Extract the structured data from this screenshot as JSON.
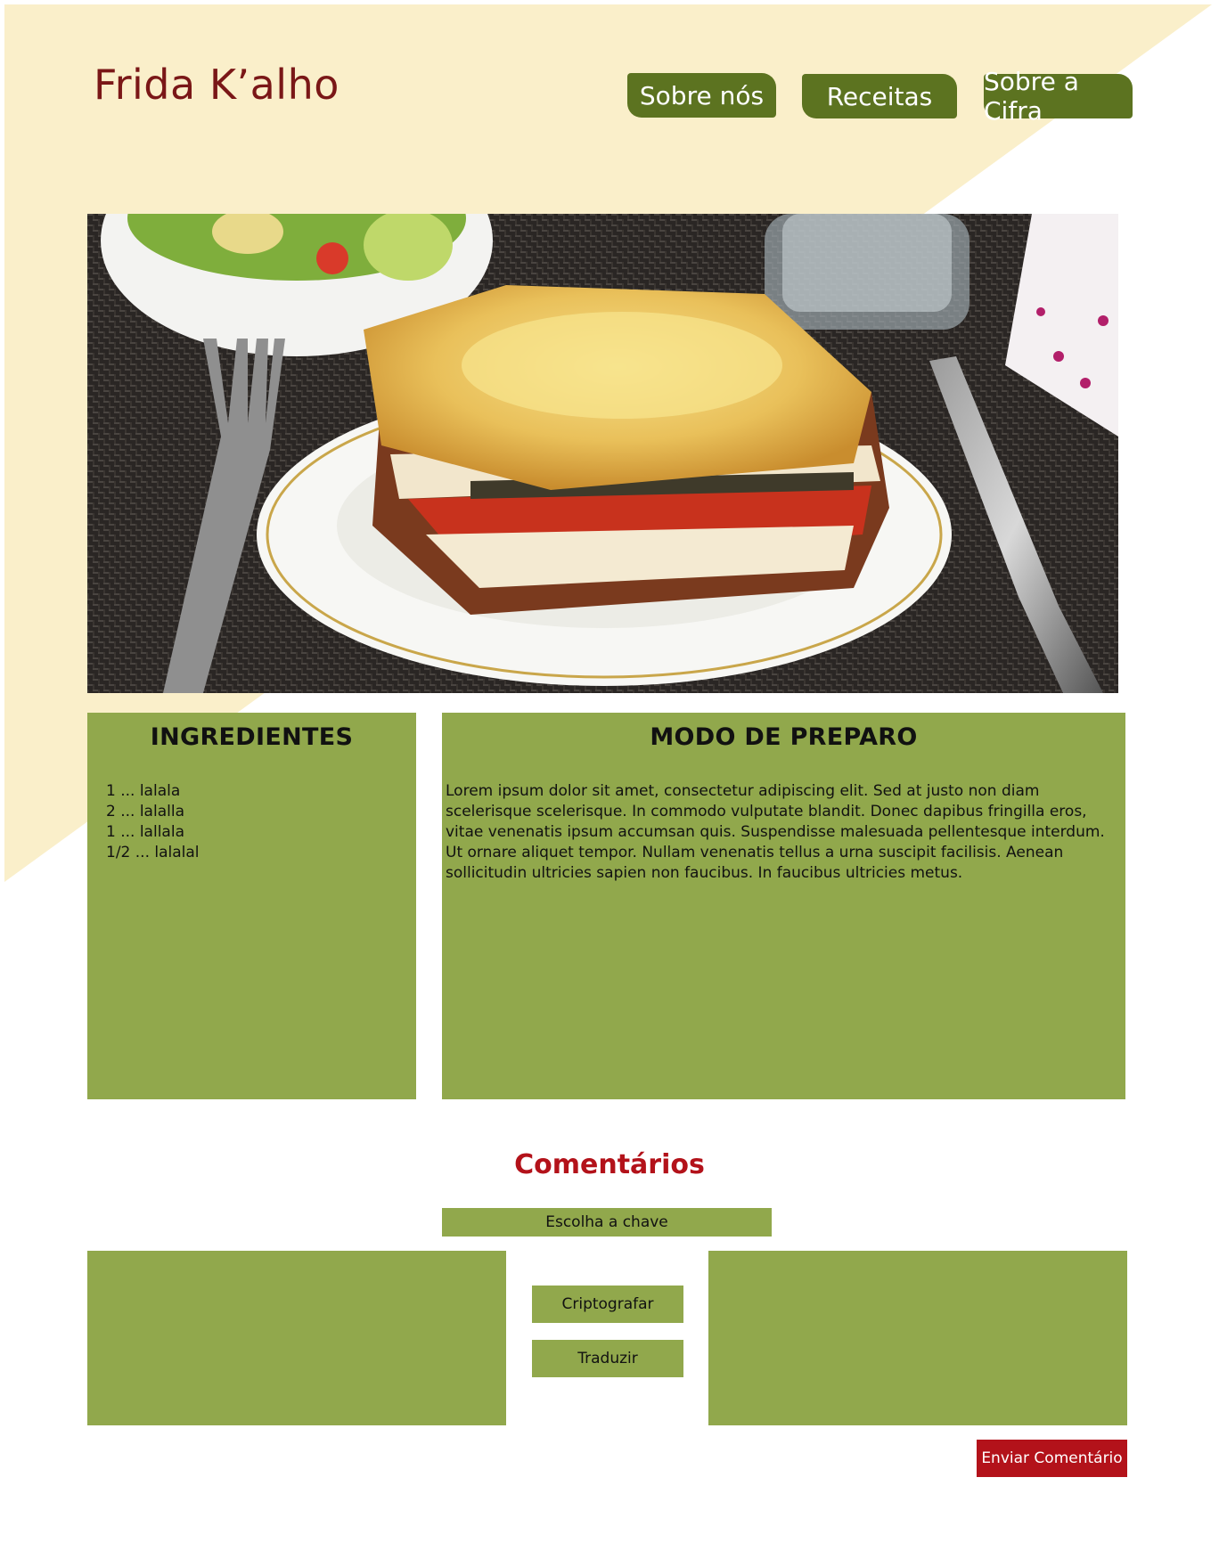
{
  "header": {
    "logo": "Frida K’alho",
    "nav": [
      {
        "label": "Sobre nós"
      },
      {
        "label": "Receitas"
      },
      {
        "label": "Sobre a Cifra"
      }
    ]
  },
  "hero": {
    "image_alt": "lasagna-photo"
  },
  "ingredients": {
    "title": "INGREDIENTES",
    "items": [
      "1 ... lalala",
      "2 ... lalalla",
      "1 ... lallala",
      "1/2 ... lalalal"
    ]
  },
  "preparation": {
    "title": "MODO DE PREPARO",
    "text": "Lorem ipsum dolor sit amet, consectetur adipiscing elit. Sed at justo non diam scelerisque scelerisque. In commodo vulputate blandit. Donec dapibus fringilla eros, vitae venenatis ipsum accumsan quis. Suspendisse malesuada pellentesque interdum. Ut ornare aliquet tempor. Nullam venenatis tellus a urna suscipit facilisis. Aenean sollicitudin ultricies sapien non faucibus. In faucibus ultricies metus."
  },
  "comments": {
    "title": "Comentários",
    "key_placeholder": "Escolha a chave",
    "encrypt_label": "Criptografar",
    "translate_label": "Traduzir",
    "send_label": "Enviar Comentário"
  },
  "colors": {
    "cream": "#faefca",
    "olive_dark": "#5c7320",
    "olive_light": "#91a84c",
    "maroon": "#7a1717",
    "red": "#b3121a"
  }
}
